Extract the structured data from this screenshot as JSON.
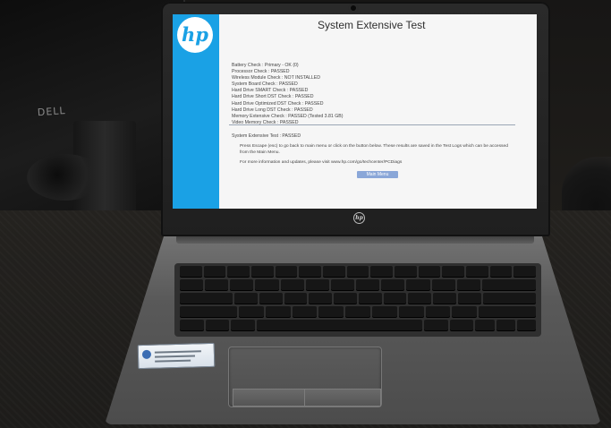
{
  "screen": {
    "title": "System Extensive Test",
    "checks": [
      "Battery Check : Primary - OK (0)",
      "Processor Check : PASSED",
      "Wireless Module Check : NOT INSTALLED",
      "System Board Check : PASSED",
      "Hard Drive SMART Check : PASSED",
      "Hard Drive Short DST Check : PASSED",
      "Hard Drive Optimized DST Check : PASSED",
      "Hard Drive Long DST Check : PASSED",
      "Memory Extensive Check : PASSED (Tested 3.81 GB)",
      "Video Memory Check : PASSED"
    ],
    "summary": "System Extensive Test : PASSED",
    "instructions": "Press Escape (esc) to go back to main menu or click on the button below. These results are saved in the Test Logs which can be accessed from the Main Menu.",
    "more_info": "For more information and updates, please visit www.hp.com/go/techcenter/PCDiags",
    "main_menu_button": "Main Menu",
    "brand_logo": "hp",
    "accent_color": "#1aa1e5"
  },
  "laptop": {
    "lid_logo": "hp"
  },
  "background": {
    "monitor_logo": "DELL"
  }
}
